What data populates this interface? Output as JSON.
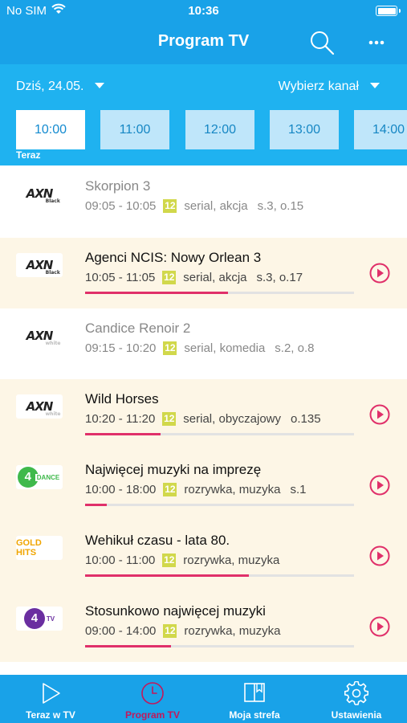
{
  "status": {
    "carrier": "No SIM",
    "time": "10:36"
  },
  "header": {
    "title": "Program TV"
  },
  "filters": {
    "date": "Dziś, 24.05.",
    "channel": "Wybierz kanał"
  },
  "hours": [
    "10:00",
    "11:00",
    "12:00",
    "13:00",
    "14:00"
  ],
  "now_label": "Teraz",
  "programs": [
    {
      "logo": "AXN Black",
      "title": "Skorpion 3",
      "time": "09:05 - 10:05",
      "age": "12",
      "genre": "serial, akcja",
      "episode": "s.3, o.15",
      "state": "past"
    },
    {
      "logo": "AXN Black",
      "title": "Agenci NCIS: Nowy Orlean 3",
      "time": "10:05 - 11:05",
      "age": "12",
      "genre": "serial, akcja",
      "episode": "s.3, o.17",
      "state": "live",
      "progress": 0.53
    },
    {
      "logo": "AXN White",
      "title": "Candice Renoir 2",
      "time": "09:15 - 10:20",
      "age": "12",
      "genre": "serial, komedia",
      "episode": "s.2, o.8",
      "state": "past"
    },
    {
      "logo": "AXN White",
      "title": "Wild Horses",
      "time": "10:20 - 11:20",
      "age": "12",
      "genre": "serial, obyczajowy",
      "episode": "o.135",
      "state": "live",
      "progress": 0.28
    },
    {
      "logo": "4Fun Dance",
      "title": "Najwięcej muzyki na imprezę",
      "time": "10:00 - 18:00",
      "age": "12",
      "genre": "rozrywka, muzyka",
      "episode": "s.1",
      "state": "live",
      "progress": 0.08
    },
    {
      "logo": "Gold Hits",
      "title": "Wehikuł czasu - lata 80.",
      "time": "10:00 - 11:00",
      "age": "12",
      "genre": "rozrywka, muzyka",
      "episode": "",
      "state": "live",
      "progress": 0.61
    },
    {
      "logo": "4Fun TV",
      "title": "Stosunkowo najwięcej muzyki",
      "time": "09:00 - 14:00",
      "age": "12",
      "genre": "rozrywka, muzyka",
      "episode": "",
      "state": "live",
      "progress": 0.32
    }
  ],
  "logos": {
    "axn": "AXN",
    "axn_black": "Black",
    "axn_white": "white",
    "dance_ball": "4",
    "dance_word": "DANCE",
    "gold": "GOLD HITS",
    "fun_ball": "4",
    "fun_word": "TV"
  },
  "tabs": [
    {
      "label": "Teraz w TV",
      "icon": "play-icon",
      "active": false
    },
    {
      "label": "Program TV",
      "icon": "clock-icon",
      "active": true
    },
    {
      "label": "Moja strefa",
      "icon": "book-icon",
      "active": false
    },
    {
      "label": "Ustawienia",
      "icon": "gear-icon",
      "active": false
    }
  ],
  "colors": {
    "header": "#19a2e8",
    "band": "#1fb2f0",
    "highlight_row": "#fdf6e6",
    "accent": "#e0306a",
    "age_badge": "#d1d84b"
  }
}
